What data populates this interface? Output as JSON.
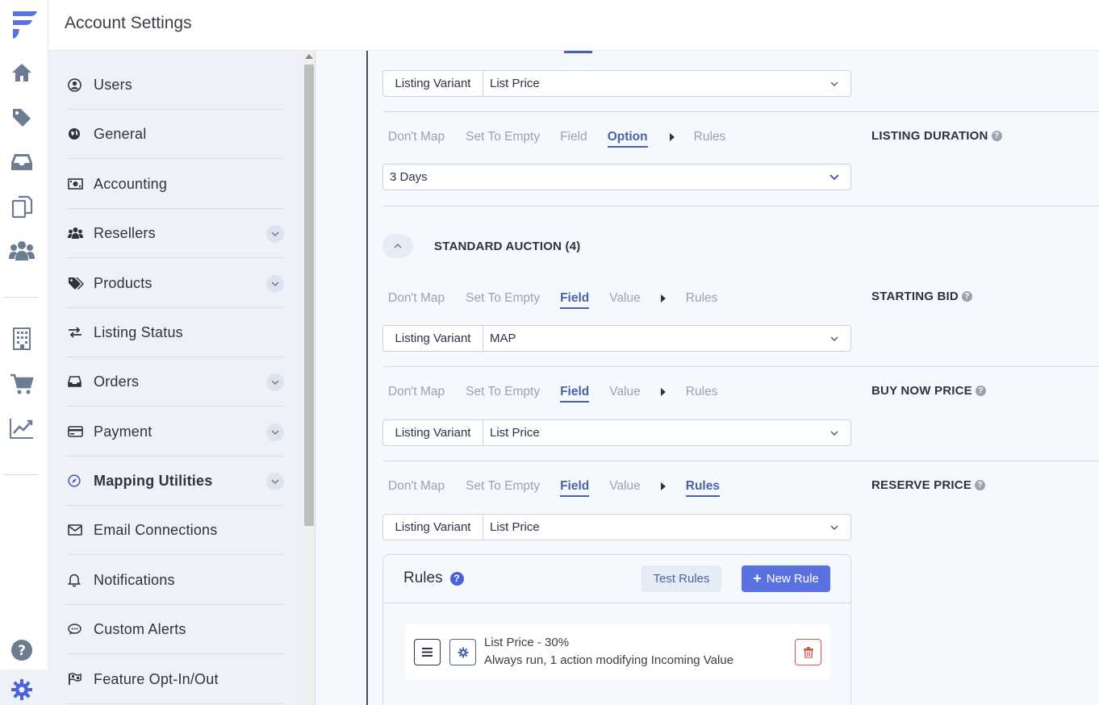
{
  "header": {
    "title": "Account Settings"
  },
  "rail": {
    "items": [
      "logo-icon",
      "home-icon",
      "tag-icon",
      "inbox-icon",
      "documents-icon",
      "users-icon",
      "building-icon",
      "cart-icon",
      "chart-icon",
      "help-icon",
      "gear-icon"
    ]
  },
  "menu": {
    "items": [
      {
        "label": "Users",
        "icon": "user-circle-icon",
        "has_chevron": false
      },
      {
        "label": "General",
        "icon": "globe-icon",
        "has_chevron": false
      },
      {
        "label": "Accounting",
        "icon": "money-icon",
        "has_chevron": false
      },
      {
        "label": "Resellers",
        "icon": "users-icon",
        "has_chevron": true
      },
      {
        "label": "Products",
        "icon": "tags-icon",
        "has_chevron": true
      },
      {
        "label": "Listing Status",
        "icon": "exchange-icon",
        "has_chevron": false
      },
      {
        "label": "Orders",
        "icon": "inbox-icon",
        "has_chevron": true
      },
      {
        "label": "Payment",
        "icon": "credit-card-icon",
        "has_chevron": true
      },
      {
        "label": "Mapping Utilities",
        "icon": "compass-icon",
        "has_chevron": true,
        "active": true
      },
      {
        "label": "Email Connections",
        "icon": "envelope-icon",
        "has_chevron": false
      },
      {
        "label": "Notifications",
        "icon": "bell-icon",
        "has_chevron": false
      },
      {
        "label": "Custom Alerts",
        "icon": "comment-icon",
        "has_chevron": false
      },
      {
        "label": "Feature Opt-In/Out",
        "icon": "flag-icon",
        "has_chevron": false
      }
    ]
  },
  "tabs_labels": {
    "dont_map": "Don't Map",
    "set_empty": "Set To Empty",
    "field": "Field",
    "option": "Option",
    "value": "Value",
    "rules": "Rules"
  },
  "top_row": {
    "prefix": "Listing Variant",
    "value": "List Price"
  },
  "listing_duration": {
    "label": "LISTING DURATION",
    "value": "3 Days"
  },
  "section": {
    "title": "STANDARD AUCTION (4)"
  },
  "starting_bid": {
    "label": "STARTING BID",
    "prefix": "Listing Variant",
    "value": "MAP"
  },
  "buy_now_price": {
    "label": "BUY NOW PRICE",
    "prefix": "Listing Variant",
    "value": "List Price"
  },
  "reserve_price": {
    "label": "RESERVE PRICE",
    "prefix": "Listing Variant",
    "value": "List Price"
  },
  "rules_panel": {
    "title": "Rules",
    "test_label": "Test Rules",
    "new_label": "New Rule",
    "rule": {
      "title": "List Price - 30%",
      "subtitle": "Always run, 1 action modifying Incoming Value"
    }
  },
  "colors": {
    "accent": "#4a63a8",
    "primary_button": "#5a72e0",
    "danger": "#d9534f",
    "menu_bg": "#eef2f8"
  }
}
